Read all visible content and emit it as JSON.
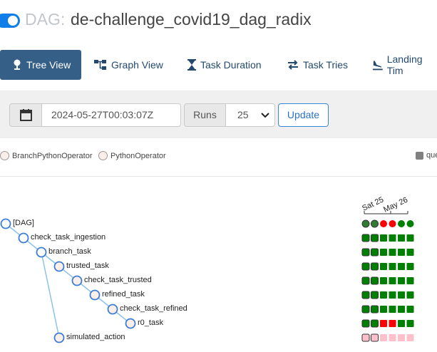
{
  "header": {
    "prefix": "DAG:",
    "dag_id": "de-challenge_covid19_dag_radix"
  },
  "nav": {
    "tabs": [
      {
        "label": "Tree View",
        "icon": "tree-icon",
        "active": true
      },
      {
        "label": "Graph View",
        "icon": "graph-icon",
        "active": false
      },
      {
        "label": "Task Duration",
        "icon": "hourglass-icon",
        "active": false
      },
      {
        "label": "Task Tries",
        "icon": "retry-icon",
        "active": false
      },
      {
        "label": "Landing Tim",
        "icon": "plane-landing-icon",
        "active": false
      }
    ]
  },
  "controls": {
    "base_date": "2024-05-27T00:03:07Z",
    "runs_label": "Runs",
    "runs_value": "25",
    "update_label": "Update"
  },
  "legend": {
    "operators": [
      "BranchPythonOperator",
      "PythonOperator"
    ],
    "state_partial": "que",
    "state_color": "#808080"
  },
  "dates": {
    "first": "Sat 25",
    "second": "May 26"
  },
  "tasks": [
    {
      "label": "[DAG]",
      "depth": 0
    },
    {
      "label": "check_task_ingestion",
      "depth": 1
    },
    {
      "label": "branch_task",
      "depth": 2
    },
    {
      "label": "trusted_task",
      "depth": 3
    },
    {
      "label": "check_task_trusted",
      "depth": 4
    },
    {
      "label": "refined_task",
      "depth": 5
    },
    {
      "label": "check_task_refined",
      "depth": 6
    },
    {
      "label": "r0_task",
      "depth": 7
    },
    {
      "label": "simulated_action",
      "depth": 3
    }
  ],
  "grid_states": [
    [
      "success-dark",
      "success-dark",
      "failed",
      "failed",
      "success",
      "success"
    ],
    [
      "success",
      "success",
      "success",
      "success",
      "success",
      "success"
    ],
    [
      "success",
      "success",
      "success",
      "success",
      "success",
      "success"
    ],
    [
      "success",
      "success",
      "success",
      "success",
      "success",
      "success"
    ],
    [
      "success",
      "success",
      "success",
      "success",
      "success",
      "success"
    ],
    [
      "success",
      "success",
      "success",
      "success",
      "success",
      "success"
    ],
    [
      "success",
      "success",
      "success",
      "success",
      "success",
      "success"
    ],
    [
      "success",
      "success",
      "failed",
      "failed",
      "success",
      "success"
    ],
    [
      "skipped",
      "skipped",
      "skipped",
      "skipped",
      "skipped",
      "skipped"
    ]
  ],
  "colors": {
    "success": "#008000",
    "success_dark": "#2f7d32",
    "failed": "#ff0000",
    "skipped": "#ffc0cb",
    "accent": "#355f86"
  }
}
